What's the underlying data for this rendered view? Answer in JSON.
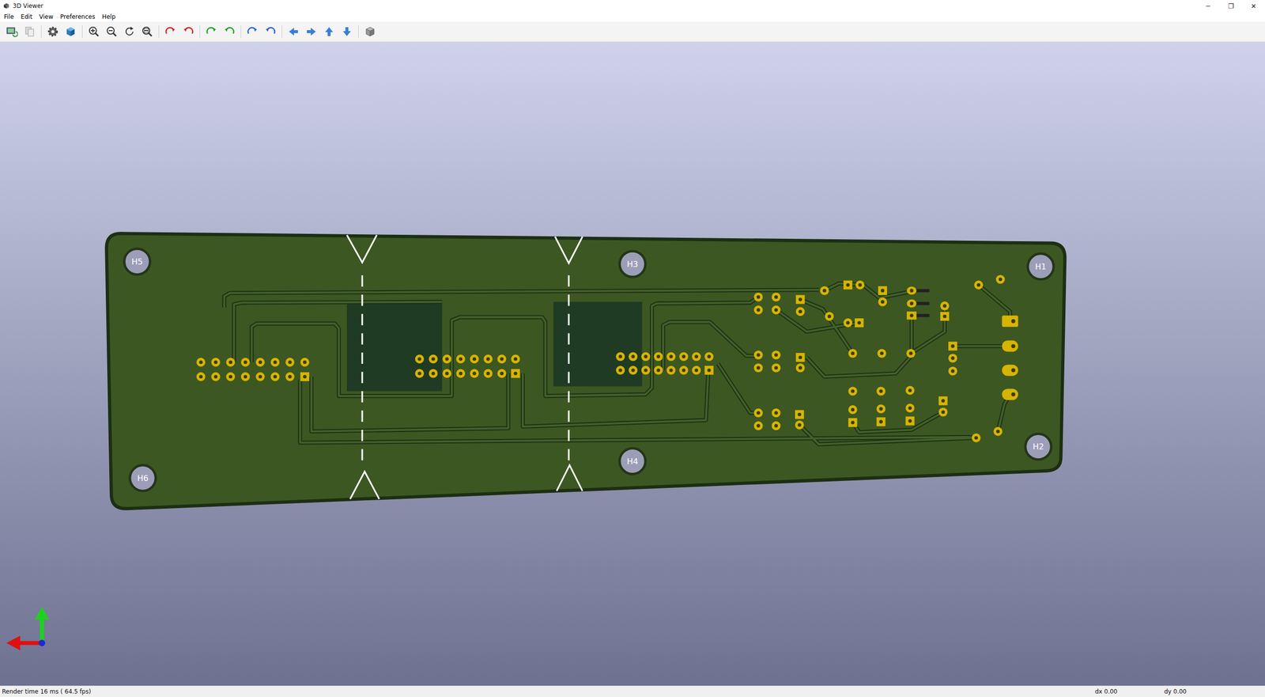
{
  "window": {
    "title": "3D Viewer",
    "controls": [
      "─",
      "❐",
      "✕"
    ]
  },
  "menu": [
    "File",
    "Edit",
    "View",
    "Preferences",
    "Help"
  ],
  "board": {
    "holes": [
      {
        "label": "H5"
      },
      {
        "label": "H6"
      },
      {
        "label": "H3"
      },
      {
        "label": "H4"
      },
      {
        "label": "H1"
      },
      {
        "label": "H2"
      }
    ]
  },
  "status_bar": {
    "render": "Render time 16 ms ( 64.5 fps)",
    "dx": "dx 0.00",
    "dy": "dy 0.00"
  }
}
